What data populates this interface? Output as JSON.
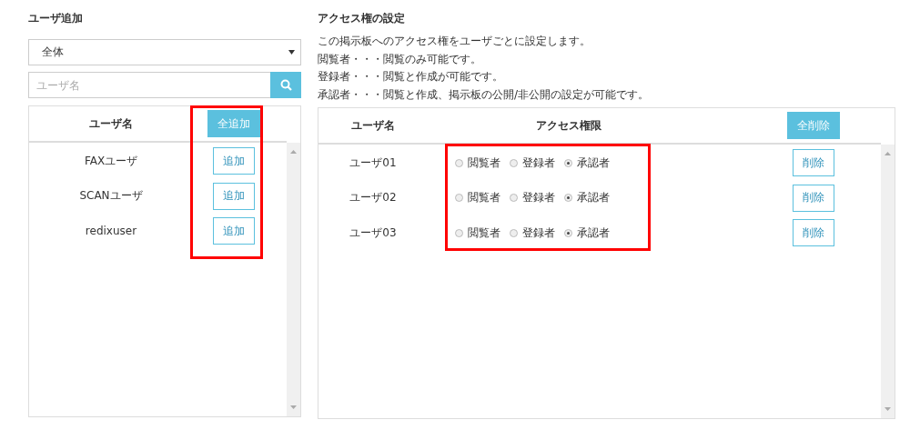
{
  "user_add": {
    "title": "ユーザ追加",
    "group_select": {
      "value": "全体"
    },
    "search": {
      "placeholder": "ユーザ名"
    },
    "table": {
      "column_header": "ユーザ名",
      "add_all_button": "全追加",
      "rows": [
        {
          "name": "FAXユーザ",
          "button": "追加"
        },
        {
          "name": "SCANユーザ",
          "button": "追加"
        },
        {
          "name": "redixuser",
          "button": "追加"
        }
      ]
    }
  },
  "access": {
    "title": "アクセス権の設定",
    "description": [
      "この掲示板へのアクセス権をユーザごとに設定します。",
      "閲覧者・・・閲覧のみ可能です。",
      "登録者・・・閲覧と作成が可能です。",
      "承認者・・・閲覧と作成、掲示板の公開/非公開の設定が可能です。"
    ],
    "table": {
      "columns": [
        "ユーザ名",
        "アクセス権限"
      ],
      "remove_all_button": "全削除",
      "rows": [
        {
          "name": "ユーザ01",
          "options": [
            {
              "label": "閲覧者",
              "selected": false
            },
            {
              "label": "登録者",
              "selected": false
            },
            {
              "label": "承認者",
              "selected": true
            }
          ],
          "button": "削除"
        },
        {
          "name": "ユーザ02",
          "options": [
            {
              "label": "閲覧者",
              "selected": false
            },
            {
              "label": "登録者",
              "selected": false
            },
            {
              "label": "承認者",
              "selected": true
            }
          ],
          "button": "削除"
        },
        {
          "name": "ユーザ03",
          "options": [
            {
              "label": "閲覧者",
              "selected": false
            },
            {
              "label": "登録者",
              "selected": false
            },
            {
              "label": "承認者",
              "selected": true
            }
          ],
          "button": "削除"
        }
      ]
    }
  }
}
